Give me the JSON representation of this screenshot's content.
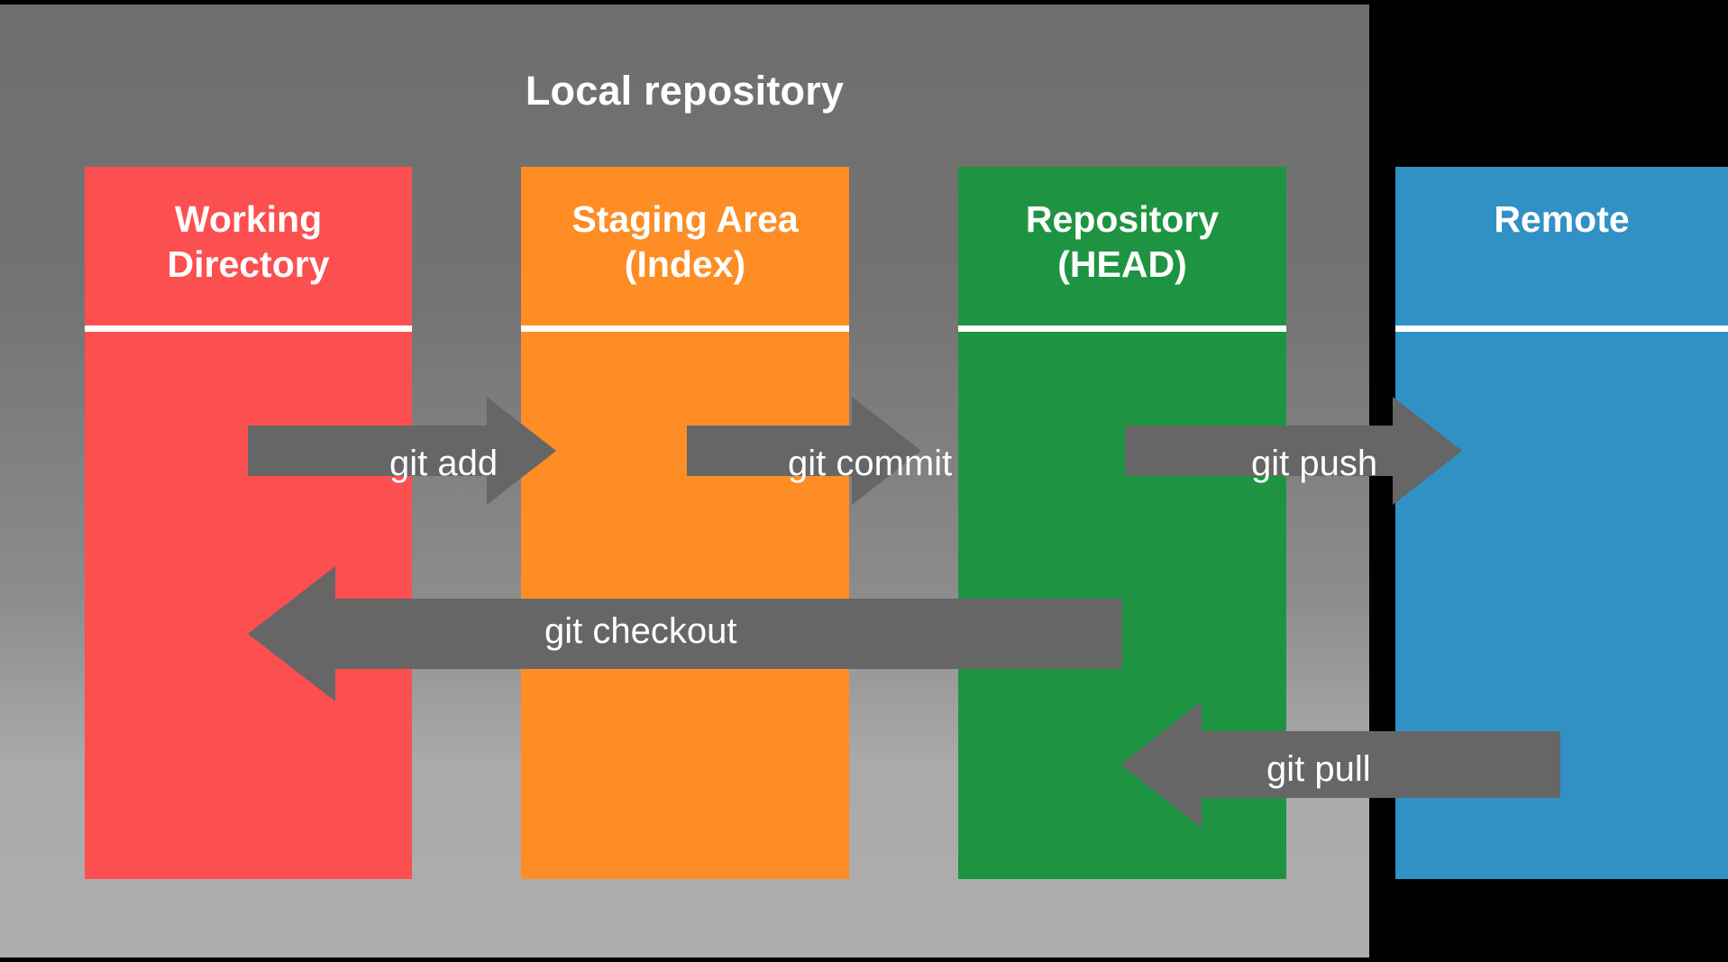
{
  "diagram": {
    "title": "Local repository",
    "background_color": "#000000",
    "local_repo_color": "#737373"
  },
  "columns": [
    {
      "id": "working",
      "label": "Working\nDirectory",
      "color": "#fc4f50"
    },
    {
      "id": "staging",
      "label": "Staging Area\n(Index)",
      "color": "#fd8d24"
    },
    {
      "id": "repository",
      "label": "Repository\n(HEAD)",
      "color": "#1e9442"
    },
    {
      "id": "remote",
      "label": "Remote",
      "color": "#3191c4"
    }
  ],
  "arrows": [
    {
      "id": "git-add",
      "label": "git add",
      "direction": "right",
      "from": "working",
      "to": "staging",
      "color": "#666666"
    },
    {
      "id": "git-commit",
      "label": "git commit",
      "direction": "right",
      "from": "staging",
      "to": "repository",
      "color": "#666666"
    },
    {
      "id": "git-push",
      "label": "git push",
      "direction": "right",
      "from": "repository",
      "to": "remote",
      "color": "#666666"
    },
    {
      "id": "git-checkout",
      "label": "git checkout",
      "direction": "left",
      "from": "repository",
      "to": "working",
      "color": "#666666"
    },
    {
      "id": "git-pull",
      "label": "git pull",
      "direction": "left",
      "from": "remote",
      "to": "repository",
      "color": "#666666"
    }
  ]
}
